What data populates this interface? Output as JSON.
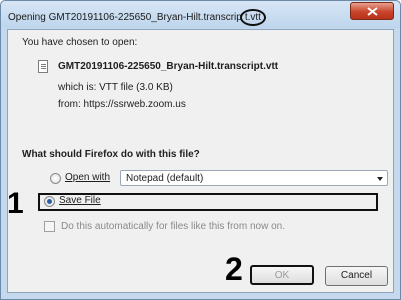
{
  "window": {
    "title_prefix": "Opening GMT20191106-225650_Bryan-Hilt.transcrip",
    "title_circled": "t.vtt"
  },
  "dialog": {
    "intro": "You have chosen to open:",
    "filename": "GMT20191106-225650_Bryan-Hilt.transcript.vtt",
    "which_is": "which is: VTT file (3.0 KB)",
    "from": "from: https://ssrweb.zoom.us",
    "question": "What should Firefox do with this file?",
    "open_with_label": "Open with",
    "open_with_value": "Notepad (default)",
    "save_file_label": "Save File",
    "auto_label": "Do this automatically for files like this from now on.",
    "ok_label": "OK",
    "cancel_label": "Cancel"
  },
  "annotations": {
    "marker_1": "1",
    "marker_2": "2"
  },
  "colors": {
    "titlebar": "#c4d9ee",
    "close_button": "#c8442a",
    "annotation": "#000000"
  }
}
